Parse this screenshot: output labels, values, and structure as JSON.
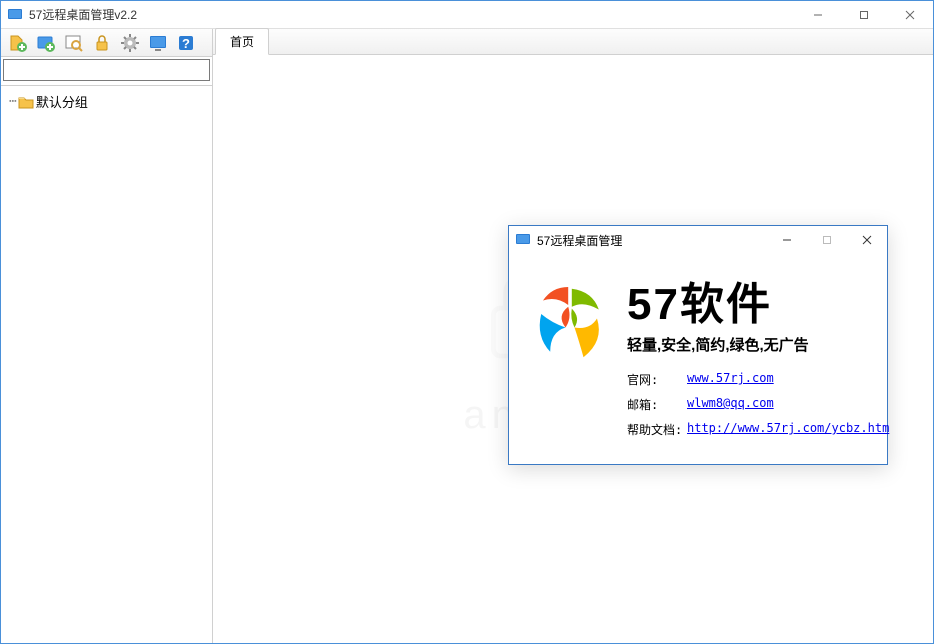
{
  "window": {
    "title": "57远程桌面管理v2.2"
  },
  "sidebar": {
    "default_group": "默认分组"
  },
  "tabs": {
    "home": "首页"
  },
  "dialog": {
    "title": "57远程桌面管理",
    "brand": "57软件",
    "slogan": "轻量,安全,简约,绿色,无广告",
    "rows": {
      "website_label": "官网:",
      "website_link": "www.57rj.com",
      "email_label": "邮箱:",
      "email_link": "wlwm8@qq.com",
      "help_label": "帮助文档:",
      "help_link": "http://www.57rj.com/ycbz.htm"
    }
  },
  "watermark": {
    "text": "anxz.com"
  }
}
